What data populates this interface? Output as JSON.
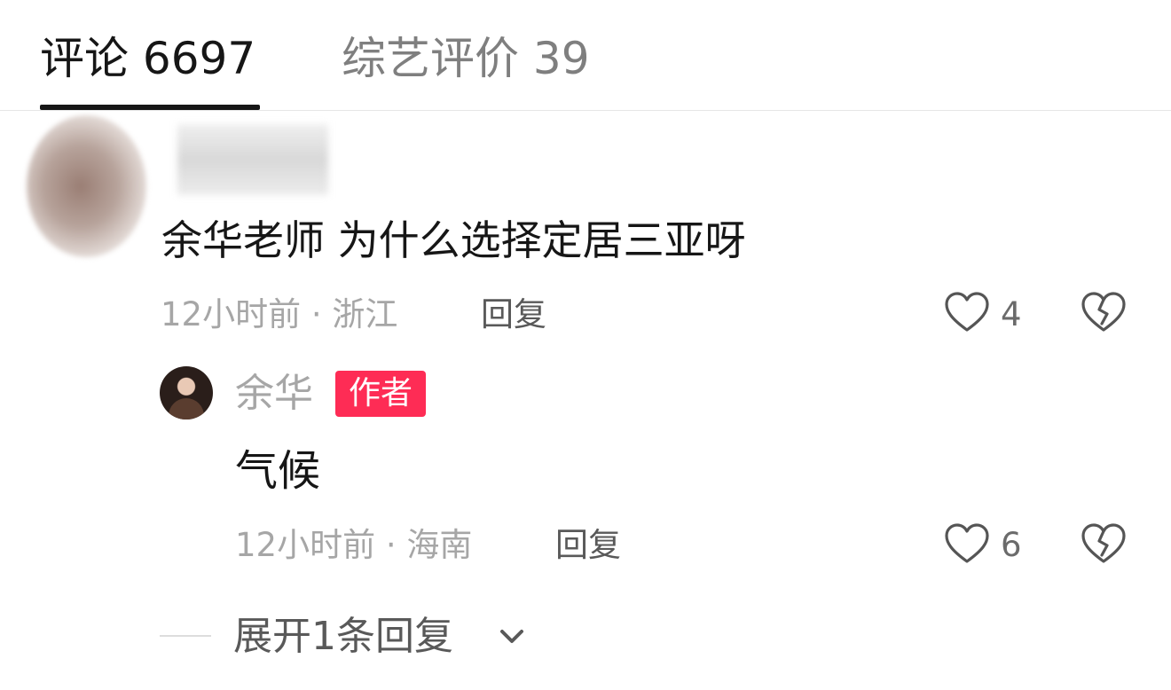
{
  "tabs": {
    "comments": "评论 6697",
    "reviews": "综艺评价 39"
  },
  "comment": {
    "text": "余华老师 为什么选择定居三亚呀",
    "time_location": "12小时前 · 浙江",
    "reply_label": "回复",
    "like_count": "4"
  },
  "reply": {
    "author": "余华",
    "badge": "作者",
    "text": "气候",
    "time_location": "12小时前 · 海南",
    "reply_label": "回复",
    "like_count": "6"
  },
  "expand": {
    "label": "展开1条回复"
  },
  "icons": {
    "like": "heart-outline-icon",
    "dislike": "broken-heart-icon",
    "expand": "chevron-down-icon"
  },
  "colors": {
    "badge": "#fe2c55",
    "primary_text": "#161616",
    "secondary_text": "#a6a6a6"
  }
}
